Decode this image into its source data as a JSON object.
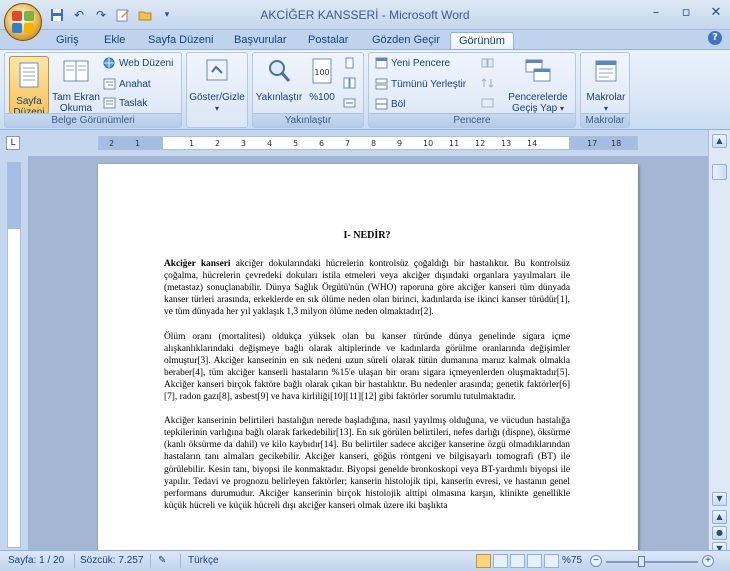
{
  "window": {
    "title": "AKCİĞER KANSSERİ - Microsoft Word",
    "controls": [
      "–",
      "▫",
      "✕"
    ]
  },
  "tabs": [
    {
      "label": "Giriş"
    },
    {
      "label": "Ekle"
    },
    {
      "label": "Sayfa Düzeni"
    },
    {
      "label": "Başvurular"
    },
    {
      "label": "Postalar"
    },
    {
      "label": "Gözden Geçir"
    },
    {
      "label": "Görünüm"
    }
  ],
  "active_tab": "Görünüm",
  "ribbon": {
    "belge": {
      "label": "Belge Görünümleri",
      "sayfa_duzeni": "Sayfa Düzeni",
      "tam_ekran": "Tam Ekran Okuma",
      "web_duzeni": "Web Düzeni",
      "anahat": "Anahat",
      "taslak": "Taslak"
    },
    "goster": {
      "label": "Göster/Gizle"
    },
    "yakinlastir": {
      "label": "Yakınlaştır",
      "zoom": "Yakınlaştır",
      "percent": "%100"
    },
    "pencere": {
      "label": "Pencere",
      "yeni": "Yeni Pencere",
      "tumunu": "Tümünü Yerleştir",
      "bol": "Böl",
      "gecis": "Pencerelerde Geçiş Yap"
    },
    "makrolar": {
      "label": "Makrolar",
      "btn": "Makrolar"
    }
  },
  "ruler": {
    "ticks": [
      "2",
      "1",
      "1",
      "2",
      "3",
      "4",
      "5",
      "6",
      "7",
      "8",
      "9",
      "10",
      "11",
      "12",
      "13",
      "14",
      "15",
      "17",
      "18"
    ]
  },
  "document": {
    "heading": "I-   NEDİR?",
    "p1": {
      "bold": "Akciğer kanseri",
      "text": " akciğer dokularındaki hücrelerin kontrolsüz çoğaldığı bir hastalıktır. Bu kontrolsüz çoğalma, hücrelerin çevredeki dokuları istila etmeleri veya akciğer dışındaki organlara yayılmaları ile (metastaz) sonuçlanabilir. Dünya Sağlık Örgütü'nün (WHO) raporuna göre akciğer kanseri tüm dünyada kanser türleri arasında, erkeklerde en sık ölüme neden olan birinci, kadınlarda ise ikinci kanser türüdür[1], ve tüm dünyada her yıl yaklaşık 1,3 milyon ölüme neden olmaktadır[2]."
    },
    "p2": "Ölüm oranı (mortalitesi) oldukça yüksek olan bu kanser türünde dünya genelinde sigara içme alışkanlıklarındaki değişmeye bağlı olarak altiplerinde ve kadınlarda görülme oranlarında değişimler olmuştur[3]. Akciğer kanserinin en sık nedeni uzun süreli olarak tütün dumanına maruz kalmak olmakla beraber[4], tüm akciğer kanserli hastaların %15'e ulaşan bir oranı sigara içmeyenlerden oluşmaktadır[5]. Akciğer kanseri birçok faktöre bağlı olarak çıkan bir hastalıktır. Bu nedenler arasında; genetik faktörler[6][7], radon gazı[8], asbest[9] ve hava kirliliği[10][11][12] gibi faktörler sorumlu tutulmaktadır.",
    "p3": "Akciğer kanserinin belirtileri hastalığın nerede başladığına, nasıl yayılmış olduğuna, ve vücudun hastalığa tepkilerinin varlığına bağlı olarak farkedebilir[13]. En sık görülen belirtileri, nefes darlığı (dispne), öksürme (kanlı öksürme da dahil) ve kilo kaybıdır[14]. Bu belirtiler sadece akciğer kanserine özgü olmadıklarından hastaların tanı almaları gecikebilir. Akciğer kanseri, göğüs röntgeni ve bilgisayarlı tomografi (BT) ile görülebilir. Kesin tanı, biyopsi ile konmaktadır. Biyopsi genelde bronkoskopi veya BT-yardımlı biyopsi ile yapılır. Tedavi ve prognozu belirleyen faktörler; kanserin histolojik tipi, kanserin evresi, ve hastanın genel performans durumudur. Akciğer kanserinin birçok histolojik alttipi olmasına karşın, klinikte genellikle küçük hücreli ve küçük hücreli dışı akciğer kanseri olmak üzere iki başlıkta"
  },
  "status": {
    "sayfa": "Sayfa: 1 / 20",
    "sozcuk": "Sözcük: 7.257",
    "dil": "Türkçe",
    "zoom": "%75"
  },
  "colors": {
    "ribbon_text": "#15428b",
    "accent": "#f7c55b",
    "workspace": "#a3b7d5"
  }
}
